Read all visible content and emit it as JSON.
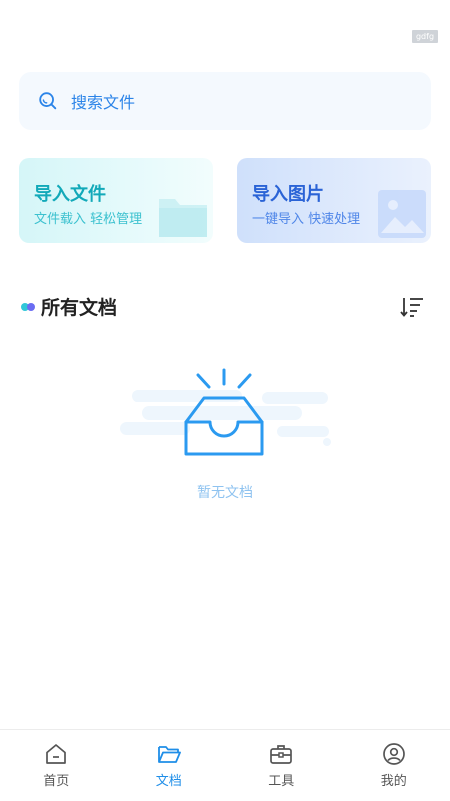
{
  "watermark": "gdfg",
  "search": {
    "placeholder": "搜索文件",
    "icon": "search-icon"
  },
  "cards": [
    {
      "title": "导入文件",
      "subtitle": "文件载入 轻松管理",
      "icon": "folder-icon"
    },
    {
      "title": "导入图片",
      "subtitle": "一键导入 快速处理",
      "icon": "image-icon"
    }
  ],
  "section": {
    "title": "所有文档",
    "sort_icon": "sort-icon"
  },
  "empty_state": {
    "text": "暂无文档",
    "icon": "empty-inbox-icon"
  },
  "tabbar": {
    "active": "文档",
    "colors": {
      "active": "#1f8ee8",
      "inactive": "#555555"
    },
    "tabs": [
      {
        "label": "首页",
        "icon": "home-icon"
      },
      {
        "label": "文档",
        "icon": "folder-open-icon"
      },
      {
        "label": "工具",
        "icon": "toolbox-icon"
      },
      {
        "label": "我的",
        "icon": "user-icon"
      }
    ]
  }
}
